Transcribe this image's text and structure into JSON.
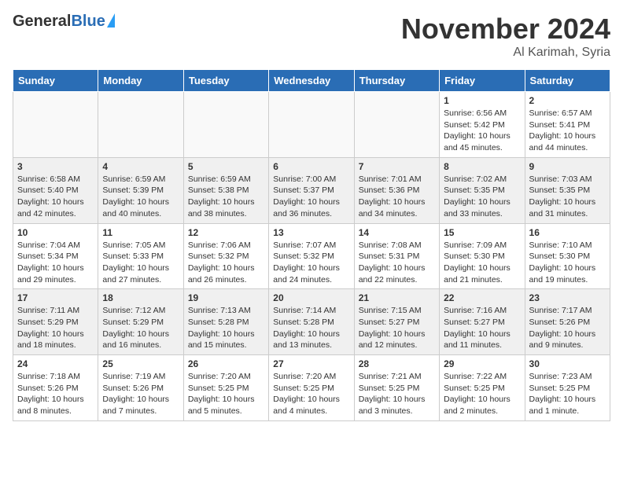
{
  "header": {
    "logo_general": "General",
    "logo_blue": "Blue",
    "title": "November 2024",
    "location": "Al Karimah, Syria"
  },
  "weekdays": [
    "Sunday",
    "Monday",
    "Tuesday",
    "Wednesday",
    "Thursday",
    "Friday",
    "Saturday"
  ],
  "weeks": [
    [
      {
        "day": "",
        "info": ""
      },
      {
        "day": "",
        "info": ""
      },
      {
        "day": "",
        "info": ""
      },
      {
        "day": "",
        "info": ""
      },
      {
        "day": "",
        "info": ""
      },
      {
        "day": "1",
        "info": "Sunrise: 6:56 AM\nSunset: 5:42 PM\nDaylight: 10 hours\nand 45 minutes."
      },
      {
        "day": "2",
        "info": "Sunrise: 6:57 AM\nSunset: 5:41 PM\nDaylight: 10 hours\nand 44 minutes."
      }
    ],
    [
      {
        "day": "3",
        "info": "Sunrise: 6:58 AM\nSunset: 5:40 PM\nDaylight: 10 hours\nand 42 minutes."
      },
      {
        "day": "4",
        "info": "Sunrise: 6:59 AM\nSunset: 5:39 PM\nDaylight: 10 hours\nand 40 minutes."
      },
      {
        "day": "5",
        "info": "Sunrise: 6:59 AM\nSunset: 5:38 PM\nDaylight: 10 hours\nand 38 minutes."
      },
      {
        "day": "6",
        "info": "Sunrise: 7:00 AM\nSunset: 5:37 PM\nDaylight: 10 hours\nand 36 minutes."
      },
      {
        "day": "7",
        "info": "Sunrise: 7:01 AM\nSunset: 5:36 PM\nDaylight: 10 hours\nand 34 minutes."
      },
      {
        "day": "8",
        "info": "Sunrise: 7:02 AM\nSunset: 5:35 PM\nDaylight: 10 hours\nand 33 minutes."
      },
      {
        "day": "9",
        "info": "Sunrise: 7:03 AM\nSunset: 5:35 PM\nDaylight: 10 hours\nand 31 minutes."
      }
    ],
    [
      {
        "day": "10",
        "info": "Sunrise: 7:04 AM\nSunset: 5:34 PM\nDaylight: 10 hours\nand 29 minutes."
      },
      {
        "day": "11",
        "info": "Sunrise: 7:05 AM\nSunset: 5:33 PM\nDaylight: 10 hours\nand 27 minutes."
      },
      {
        "day": "12",
        "info": "Sunrise: 7:06 AM\nSunset: 5:32 PM\nDaylight: 10 hours\nand 26 minutes."
      },
      {
        "day": "13",
        "info": "Sunrise: 7:07 AM\nSunset: 5:32 PM\nDaylight: 10 hours\nand 24 minutes."
      },
      {
        "day": "14",
        "info": "Sunrise: 7:08 AM\nSunset: 5:31 PM\nDaylight: 10 hours\nand 22 minutes."
      },
      {
        "day": "15",
        "info": "Sunrise: 7:09 AM\nSunset: 5:30 PM\nDaylight: 10 hours\nand 21 minutes."
      },
      {
        "day": "16",
        "info": "Sunrise: 7:10 AM\nSunset: 5:30 PM\nDaylight: 10 hours\nand 19 minutes."
      }
    ],
    [
      {
        "day": "17",
        "info": "Sunrise: 7:11 AM\nSunset: 5:29 PM\nDaylight: 10 hours\nand 18 minutes."
      },
      {
        "day": "18",
        "info": "Sunrise: 7:12 AM\nSunset: 5:29 PM\nDaylight: 10 hours\nand 16 minutes."
      },
      {
        "day": "19",
        "info": "Sunrise: 7:13 AM\nSunset: 5:28 PM\nDaylight: 10 hours\nand 15 minutes."
      },
      {
        "day": "20",
        "info": "Sunrise: 7:14 AM\nSunset: 5:28 PM\nDaylight: 10 hours\nand 13 minutes."
      },
      {
        "day": "21",
        "info": "Sunrise: 7:15 AM\nSunset: 5:27 PM\nDaylight: 10 hours\nand 12 minutes."
      },
      {
        "day": "22",
        "info": "Sunrise: 7:16 AM\nSunset: 5:27 PM\nDaylight: 10 hours\nand 11 minutes."
      },
      {
        "day": "23",
        "info": "Sunrise: 7:17 AM\nSunset: 5:26 PM\nDaylight: 10 hours\nand 9 minutes."
      }
    ],
    [
      {
        "day": "24",
        "info": "Sunrise: 7:18 AM\nSunset: 5:26 PM\nDaylight: 10 hours\nand 8 minutes."
      },
      {
        "day": "25",
        "info": "Sunrise: 7:19 AM\nSunset: 5:26 PM\nDaylight: 10 hours\nand 7 minutes."
      },
      {
        "day": "26",
        "info": "Sunrise: 7:20 AM\nSunset: 5:25 PM\nDaylight: 10 hours\nand 5 minutes."
      },
      {
        "day": "27",
        "info": "Sunrise: 7:20 AM\nSunset: 5:25 PM\nDaylight: 10 hours\nand 4 minutes."
      },
      {
        "day": "28",
        "info": "Sunrise: 7:21 AM\nSunset: 5:25 PM\nDaylight: 10 hours\nand 3 minutes."
      },
      {
        "day": "29",
        "info": "Sunrise: 7:22 AM\nSunset: 5:25 PM\nDaylight: 10 hours\nand 2 minutes."
      },
      {
        "day": "30",
        "info": "Sunrise: 7:23 AM\nSunset: 5:25 PM\nDaylight: 10 hours\nand 1 minute."
      }
    ]
  ]
}
